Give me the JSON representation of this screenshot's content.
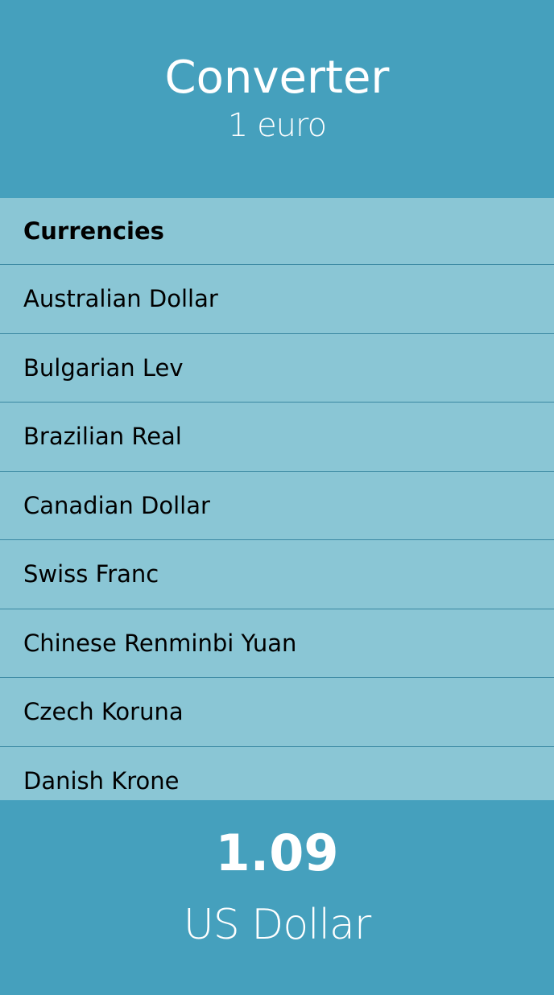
{
  "header": {
    "title": "Converter",
    "subtitle": "1 euro"
  },
  "list": {
    "heading": "Currencies",
    "items": [
      "Australian Dollar",
      "Bulgarian Lev",
      "Brazilian Real",
      "Canadian Dollar",
      "Swiss Franc",
      "Chinese Renminbi Yuan",
      "Czech Koruna",
      "Danish Krone"
    ]
  },
  "result": {
    "value": "1.09",
    "currency": "US Dollar"
  },
  "colors": {
    "primary": "#45a0bd",
    "list_background": "#8ac6d5",
    "divider": "#3a88a2"
  }
}
